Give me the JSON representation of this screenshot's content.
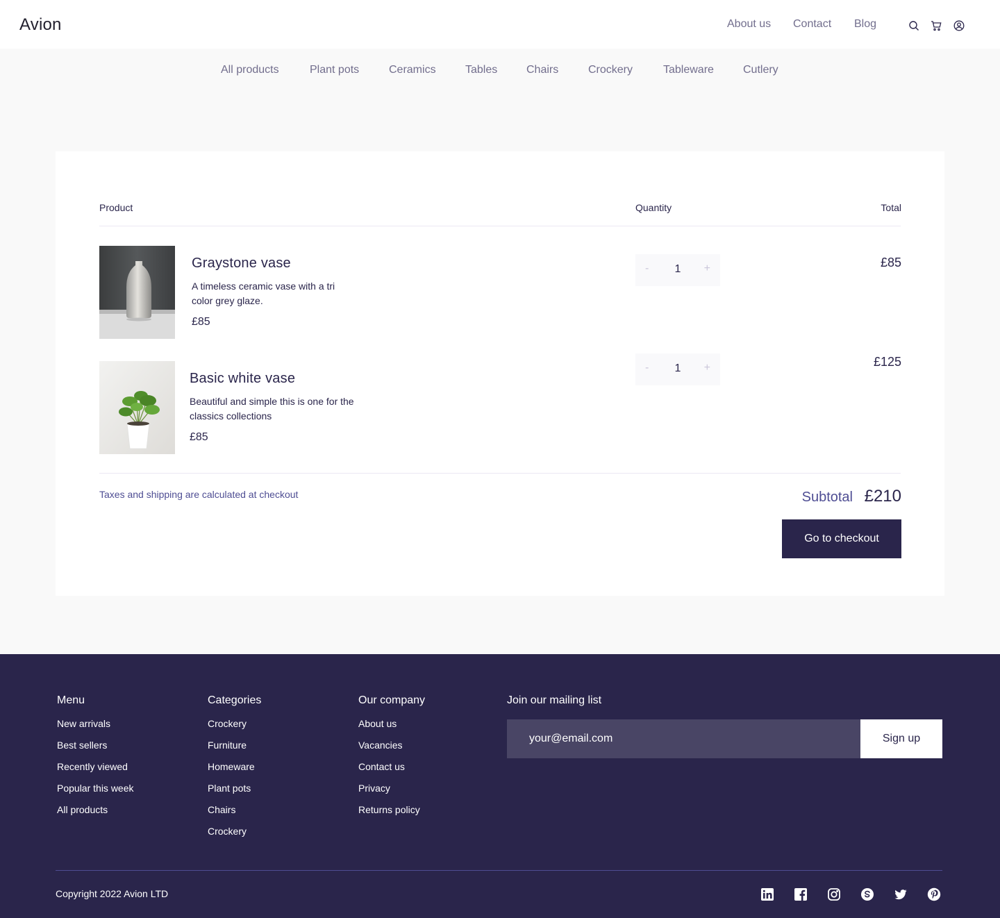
{
  "header": {
    "logo": "Avion",
    "nav": [
      "About us",
      "Contact",
      "Blog"
    ],
    "icons": [
      "search-icon",
      "cart-icon",
      "user-icon"
    ]
  },
  "categories": [
    "All products",
    "Plant pots",
    "Ceramics",
    "Tables",
    "Chairs",
    "Crockery",
    "Tableware",
    "Cutlery"
  ],
  "cart": {
    "columns": {
      "product": "Product",
      "quantity": "Quantity",
      "total": "Total"
    },
    "items": [
      {
        "name": "Graystone vase",
        "description": "A timeless ceramic vase with a tri color grey glaze.",
        "price": "£85",
        "quantity": "1",
        "total": "£85",
        "qty_minus": "-",
        "qty_plus": "+"
      },
      {
        "name": "Basic white vase",
        "description": "Beautiful and simple this is one for the classics collections",
        "price": "£85",
        "quantity": "1",
        "total": "£125",
        "qty_minus": "-",
        "qty_plus": "+"
      }
    ],
    "note": "Taxes and shipping are calculated at checkout",
    "subtotal_label": "Subtotal",
    "subtotal_value": "£210",
    "checkout_label": "Go to checkout"
  },
  "footer": {
    "menu": {
      "title": "Menu",
      "links": [
        "New arrivals",
        "Best sellers",
        "Recently viewed",
        "Popular this week",
        "All products"
      ]
    },
    "categories": {
      "title": "Categories",
      "links": [
        "Crockery",
        "Furniture",
        "Homeware",
        "Plant pots",
        "Chairs",
        "Crockery"
      ]
    },
    "company": {
      "title": "Our company",
      "links": [
        "About us",
        "Vacancies",
        "Contact us",
        "Privacy",
        "Returns policy"
      ]
    },
    "mailing": {
      "title": "Join our mailing list",
      "placeholder": "your@email.com",
      "button": "Sign up"
    },
    "copyright": "Copyright 2022 Avion LTD",
    "social": [
      "linkedin-icon",
      "facebook-icon",
      "instagram-icon",
      "skype-icon",
      "twitter-icon",
      "pinterest-icon"
    ]
  },
  "colors": {
    "primary": "#2A254B",
    "muted": "#726E8D",
    "accent": "#4E4D93",
    "background": "#F9F9F9"
  }
}
